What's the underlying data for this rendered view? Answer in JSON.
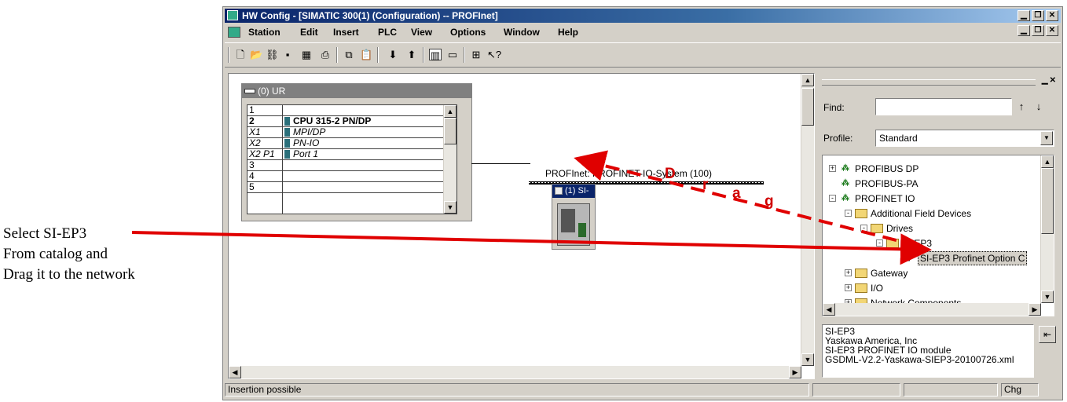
{
  "annotation": {
    "lines": [
      "Select SI-EP3",
      "From catalog and",
      "Drag it to the network"
    ],
    "drag_letters": [
      "D",
      "r",
      "a",
      "g"
    ]
  },
  "window": {
    "title": "HW Config - [SIMATIC 300(1) (Configuration) -- PROFInet]",
    "title_buttons": [
      "▁",
      "❐",
      "✕"
    ],
    "menu_buttons": [
      "▁",
      "❐",
      "✕"
    ]
  },
  "menu": [
    "Station",
    "Edit",
    "Insert",
    "PLC",
    "View",
    "Options",
    "Window",
    "Help"
  ],
  "toolbar": {
    "icons": [
      "new-icon",
      "open-icon",
      "accessible-nodes-icon",
      "save-icon",
      "save-compile-icon",
      "print-icon",
      "copy-icon",
      "paste-icon",
      "download-icon",
      "upload-icon",
      "catalog-icon",
      "view-icon",
      "network-icon",
      "help-icon"
    ]
  },
  "rack": {
    "title": "(0) UR",
    "rows": [
      {
        "slot": "1",
        "module": "",
        "bold": false,
        "italic": false
      },
      {
        "slot": "2",
        "module": "CPU 315-2 PN/DP",
        "bold": true,
        "italic": false
      },
      {
        "slot": "X1",
        "module": "MPI/DP",
        "bold": false,
        "italic": true
      },
      {
        "slot": "X2",
        "module": "PN-IO",
        "bold": false,
        "italic": true
      },
      {
        "slot": "X2 P1",
        "module": "Port 1",
        "bold": false,
        "italic": true
      },
      {
        "slot": "3",
        "module": "",
        "bold": false,
        "italic": false
      },
      {
        "slot": "4",
        "module": "",
        "bold": false,
        "italic": false
      },
      {
        "slot": "5",
        "module": "",
        "bold": false,
        "italic": false
      }
    ]
  },
  "network": {
    "label": "PROFInet: PROFINET-IO-System (100)",
    "device_title": "(1) SI-"
  },
  "catalog": {
    "find_label": "Find:",
    "find_value": "",
    "profile_label": "Profile:",
    "profile_value": "Standard",
    "tree": [
      {
        "label": "PROFIBUS DP",
        "level": 0,
        "expander": "+",
        "icon": "network"
      },
      {
        "label": "PROFIBUS-PA",
        "level": 0,
        "expander": "",
        "icon": "network"
      },
      {
        "label": "PROFINET IO",
        "level": 0,
        "expander": "-",
        "icon": "network"
      },
      {
        "label": "Additional Field Devices",
        "level": 1,
        "expander": "-",
        "icon": "folder"
      },
      {
        "label": "Drives",
        "level": 2,
        "expander": "-",
        "icon": "folder"
      },
      {
        "label": "SI-EP3",
        "level": 3,
        "expander": "-",
        "icon": "folder"
      },
      {
        "label": "SI-EP3 Profinet Option C",
        "level": 4,
        "expander": "",
        "icon": "device",
        "selected": true
      },
      {
        "label": "Gateway",
        "level": 1,
        "expander": "+",
        "icon": "folder"
      },
      {
        "label": "I/O",
        "level": 1,
        "expander": "+",
        "icon": "folder"
      },
      {
        "label": "Network Components",
        "level": 1,
        "expander": "+",
        "icon": "folder"
      }
    ],
    "info_lines": [
      "SI-EP3",
      "Yaskawa America, Inc",
      "SI-EP3 PROFINET IO module",
      "GSDML-V2.2-Yaskawa-SIEP3-20100726.xml"
    ]
  },
  "status": {
    "text": "Insertion possible",
    "chg": "Chg"
  },
  "colors": {
    "arrow": "#e00000",
    "titlebar": "#0a246a",
    "selection": "#d4d0c8"
  }
}
